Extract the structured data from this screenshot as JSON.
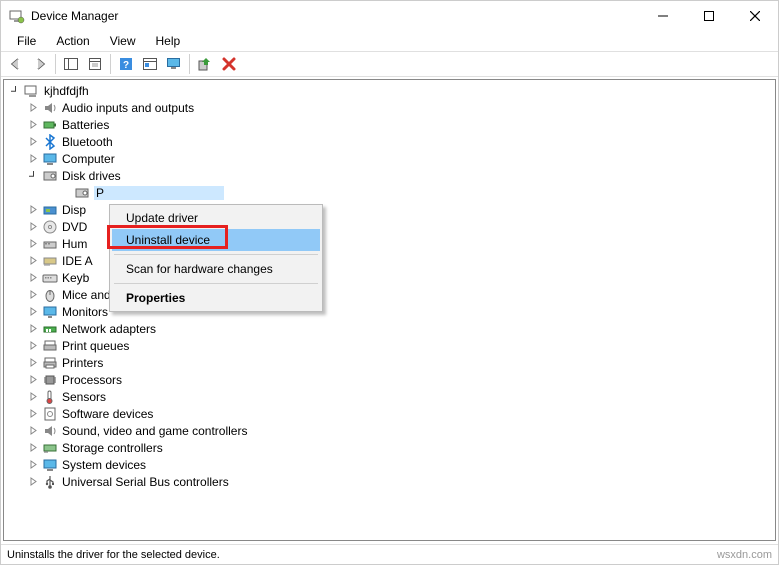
{
  "window": {
    "title": "Device Manager"
  },
  "menubar": {
    "file": "File",
    "action": "Action",
    "view": "View",
    "help": "Help"
  },
  "tree": {
    "root": "kjhdfdjfh",
    "audio": "Audio inputs and outputs",
    "batteries": "Batteries",
    "bluetooth": "Bluetooth",
    "computer": "Computer",
    "disk_drives": "Disk drives",
    "disk_child": "P",
    "display": "Disp",
    "dvd": "DVD",
    "hid": "Hum",
    "ide": "IDE A",
    "keyboards": "Keyb",
    "mice": "Mice and other pointing devices",
    "monitors": "Monitors",
    "network": "Network adapters",
    "print_queues": "Print queues",
    "printers": "Printers",
    "processors": "Processors",
    "sensors": "Sensors",
    "software": "Software devices",
    "sound": "Sound, video and game controllers",
    "storage": "Storage controllers",
    "system": "System devices",
    "usb": "Universal Serial Bus controllers"
  },
  "context_menu": {
    "update": "Update driver",
    "uninstall": "Uninstall device",
    "scan": "Scan for hardware changes",
    "properties": "Properties"
  },
  "statusbar": {
    "text": "Uninstalls the driver for the selected device.",
    "watermark": "wsxdn.com"
  }
}
